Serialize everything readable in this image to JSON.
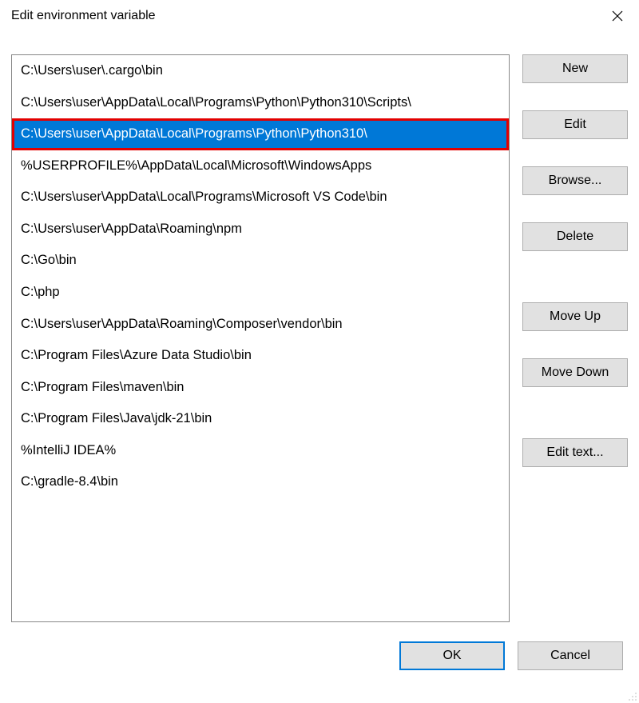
{
  "window": {
    "title": "Edit environment variable"
  },
  "list": {
    "selectedIndex": 2,
    "items": [
      "C:\\Users\\user\\.cargo\\bin",
      "C:\\Users\\user\\AppData\\Local\\Programs\\Python\\Python310\\Scripts\\",
      "C:\\Users\\user\\AppData\\Local\\Programs\\Python\\Python310\\",
      "%USERPROFILE%\\AppData\\Local\\Microsoft\\WindowsApps",
      "C:\\Users\\user\\AppData\\Local\\Programs\\Microsoft VS Code\\bin",
      "C:\\Users\\user\\AppData\\Roaming\\npm",
      "C:\\Go\\bin",
      "C:\\php",
      "C:\\Users\\user\\AppData\\Roaming\\Composer\\vendor\\bin",
      "C:\\Program Files\\Azure Data Studio\\bin",
      "C:\\Program Files\\maven\\bin",
      "C:\\Program Files\\Java\\jdk-21\\bin",
      "%IntelliJ IDEA%",
      "C:\\gradle-8.4\\bin"
    ]
  },
  "buttons": {
    "new_label": "New",
    "edit_label": "Edit",
    "browse_label": "Browse...",
    "delete_label": "Delete",
    "moveup_label": "Move Up",
    "movedown_label": "Move Down",
    "edittext_label": "Edit text...",
    "ok_label": "OK",
    "cancel_label": "Cancel"
  }
}
